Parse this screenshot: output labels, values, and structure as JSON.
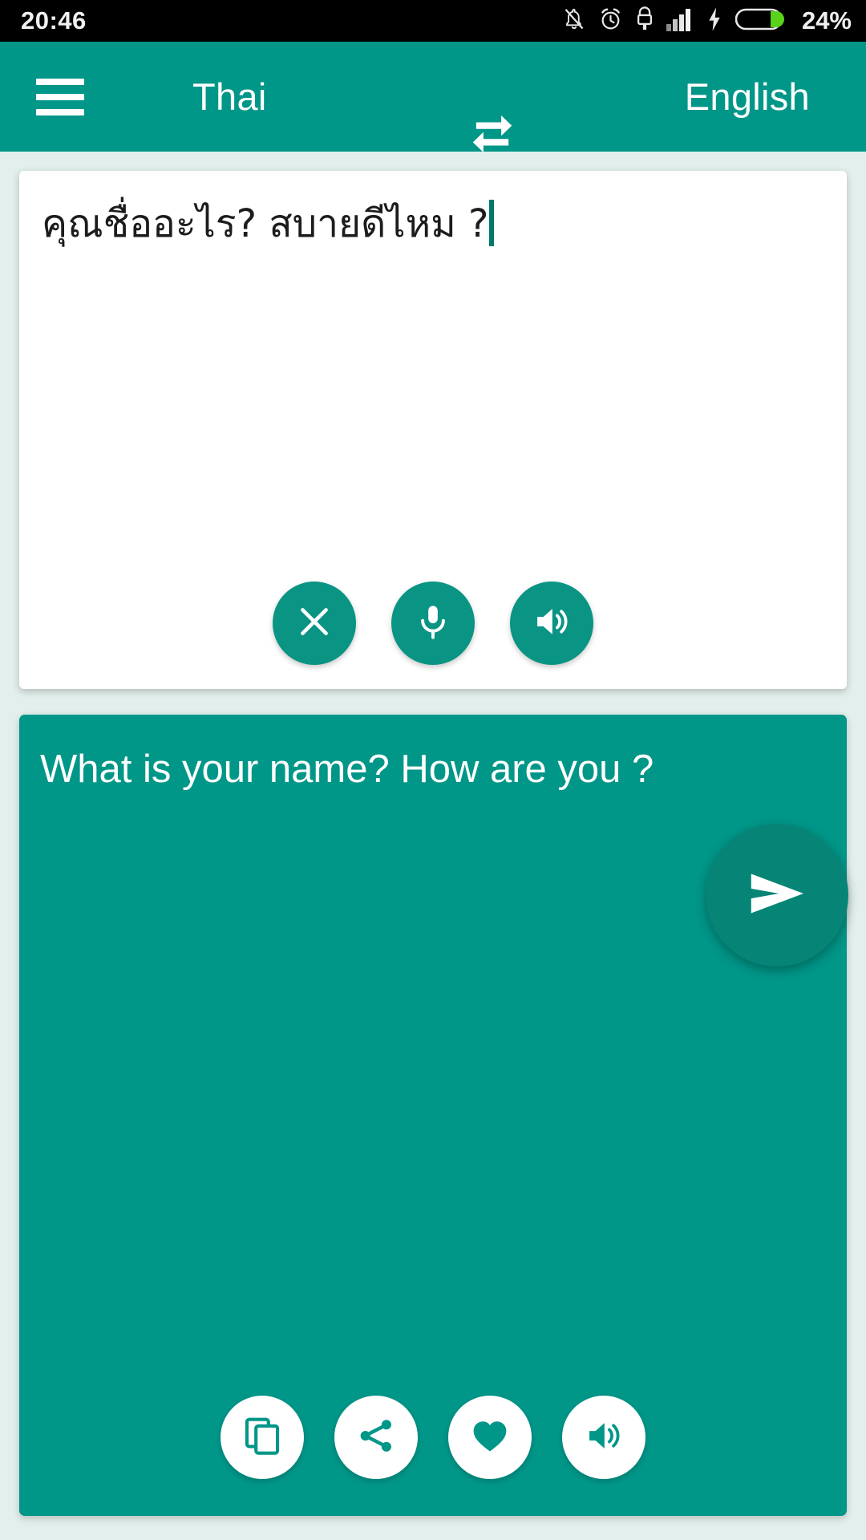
{
  "status_bar": {
    "clock": "20:46",
    "battery_percent": "24%",
    "icons": [
      "bell-off-icon",
      "alarm-clock-icon",
      "usb-lock-icon",
      "signal-bars-icon",
      "charging-bolt-icon",
      "battery-icon"
    ],
    "background_color": "#000000",
    "text_color": "#f0f0f0",
    "battery_fill_color": "#58d21a"
  },
  "app_bar": {
    "menu_icon": "hamburger-menu-icon",
    "source_language": "Thai",
    "swap_icon": "swap-languages-icon",
    "target_language": "English",
    "background_color": "#009688",
    "text_color": "#ffffff"
  },
  "source_card": {
    "text": "คุณชื่ออะไร? สบายดีไหม ?",
    "cursor_visible": true,
    "cursor_color": "#00796b",
    "background_color": "#ffffff",
    "text_color": "#1c1c1c",
    "actions": [
      {
        "name": "clear-button",
        "icon": "close-icon"
      },
      {
        "name": "microphone-button",
        "icon": "microphone-icon"
      },
      {
        "name": "speak-source-button",
        "icon": "volume-icon"
      }
    ]
  },
  "send_button": {
    "icon": "send-icon",
    "background_color": "#068576",
    "icon_color": "#ffffff"
  },
  "target_card": {
    "text": "What is your name? How are you ?",
    "background_color": "#009688",
    "text_color": "#ffffff",
    "actions": [
      {
        "name": "copy-button",
        "icon": "copy-icon"
      },
      {
        "name": "share-button",
        "icon": "share-icon"
      },
      {
        "name": "favorite-button",
        "icon": "heart-icon"
      },
      {
        "name": "speak-translation-button",
        "icon": "volume-icon"
      }
    ]
  },
  "page": {
    "background_color": "#e2efec"
  }
}
